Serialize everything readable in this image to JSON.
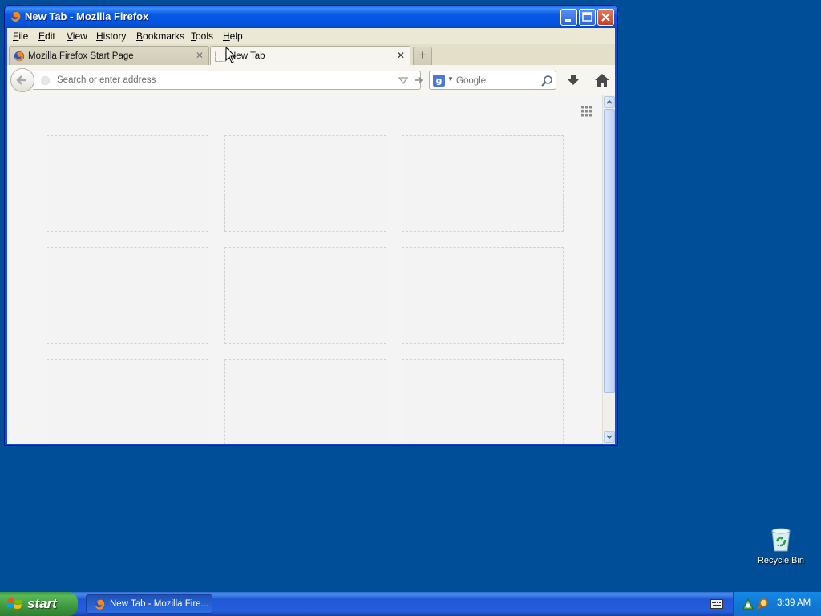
{
  "window": {
    "title": "New Tab - Mozilla Firefox",
    "buttons": [
      "minimize",
      "maximize",
      "close"
    ]
  },
  "menubar": {
    "items": [
      "File",
      "Edit",
      "View",
      "History",
      "Bookmarks",
      "Tools",
      "Help"
    ]
  },
  "tabs": [
    {
      "label": "Mozilla Firefox Start Page",
      "active": false,
      "icon": "firefox-icon"
    },
    {
      "label": "New Tab",
      "active": true,
      "icon": "blank-page-icon"
    }
  ],
  "navbar": {
    "url_placeholder": "Search or enter address",
    "search_placeholder": "Google",
    "search_engine_icon": "google-icon"
  },
  "content": {
    "tile_count": 9,
    "grid_toggle_icon": "grid-icon"
  },
  "desktop": {
    "recycle_bin_label": "Recycle Bin"
  },
  "taskbar": {
    "start_label": "start",
    "task_label": "New Tab - Mozilla Fire...",
    "clock": "3:39 AM"
  },
  "colors": {
    "desktop": "#004e98",
    "titlebar": "#0758e6",
    "start_button": "#3f993f",
    "tray": "#0f7ad6"
  }
}
